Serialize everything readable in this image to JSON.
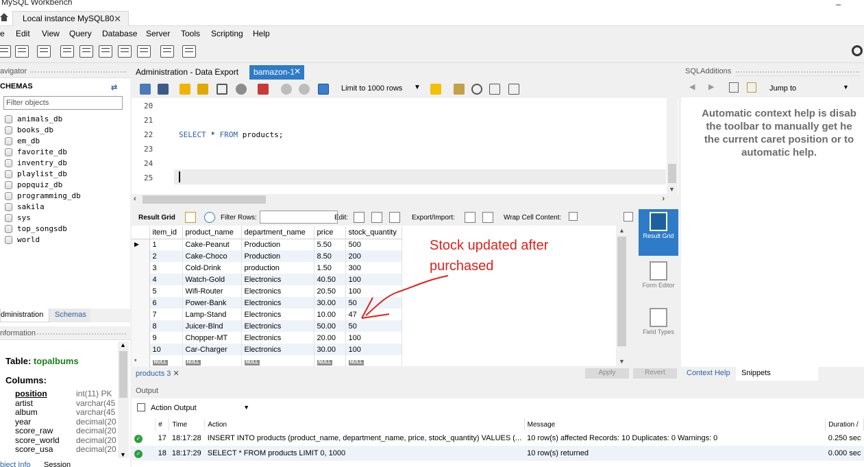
{
  "window": {
    "title": "MySQL Workbench",
    "instance_tab": "Local instance MySQL80"
  },
  "menu": [
    "e",
    "Edit",
    "View",
    "Query",
    "Database",
    "Server",
    "Tools",
    "Scripting",
    "Help"
  ],
  "navigator": {
    "header": "avigator",
    "schemas_label": "CHEMAS",
    "filter_placeholder": "Filter objects",
    "schemas": [
      "animals_db",
      "books_db",
      "em_db",
      "favorite_db",
      "inventry_db",
      "playlist_db",
      "popquiz_db",
      "programming_db",
      "sakila",
      "sys",
      "top_songsdb",
      "world"
    ],
    "tabs": [
      "dministration",
      "Schemas"
    ]
  },
  "information": {
    "header": "nformation",
    "table_label": "Table:",
    "table_name": "topalbums",
    "columns_label": "Columns:",
    "columns": [
      {
        "name": "position",
        "type": "int(11) PK"
      },
      {
        "name": "artist",
        "type": "varchar(45"
      },
      {
        "name": "album",
        "type": "varchar(45"
      },
      {
        "name": "year",
        "type": "decimal(20"
      },
      {
        "name": "score_raw",
        "type": "decimal(20"
      },
      {
        "name": "score_world",
        "type": "decimal(20"
      },
      {
        "name": "score_usa",
        "type": "decimal(20"
      }
    ],
    "bottom_tabs": [
      "bject Info",
      "Session"
    ]
  },
  "editor": {
    "tabs": [
      "Administration - Data Export",
      "bamazon-1"
    ],
    "limit_label": "Limit to 1000 rows",
    "lines": [
      "20",
      "21",
      "22",
      "23",
      "24",
      "25"
    ],
    "sql_keyword_1": "SELECT",
    "sql_star": "*",
    "sql_keyword_2": "FROM",
    "sql_rest": "products;"
  },
  "result_toolbar": {
    "result_grid": "Result Grid",
    "filter_rows": "Filter Rows:",
    "edit": "Edit:",
    "export_import": "Export/Import:",
    "wrap": "Wrap Cell Content:"
  },
  "grid": {
    "columns": [
      "item_id",
      "product_name",
      "department_name",
      "price",
      "stock_quantity"
    ],
    "rows": [
      [
        "1",
        "Cake-Peanut",
        "Production",
        "5.50",
        "500"
      ],
      [
        "2",
        "Cake-Choco",
        "Production",
        "8.50",
        "200"
      ],
      [
        "3",
        "Cold-Drink",
        "production",
        "1.50",
        "300"
      ],
      [
        "4",
        "Watch-Gold",
        "Electronics",
        "40.50",
        "100"
      ],
      [
        "5",
        "Wifi-Router",
        "Electronics",
        "20.50",
        "100"
      ],
      [
        "6",
        "Power-Bank",
        "Electronics",
        "30.00",
        "50"
      ],
      [
        "7",
        "Lamp-Stand",
        "Electronics",
        "10.00",
        "47"
      ],
      [
        "8",
        "Juicer-Blnd",
        "Electronics",
        "50.00",
        "50"
      ],
      [
        "9",
        "Chopper-MT",
        "Electronics",
        "20.00",
        "100"
      ],
      [
        "10",
        "Car-Charger",
        "Electronics",
        "30.00",
        "100"
      ]
    ],
    "null_label": "NULL"
  },
  "annotation": {
    "line1": "Stock updated after",
    "line2": "purchased",
    "color": "#e0201a"
  },
  "side_panel": [
    "Result Grid",
    "Form Editor",
    "Field Types"
  ],
  "result_footer": {
    "tab": "products 3",
    "apply": "Apply",
    "revert": "Revert"
  },
  "output": {
    "header": "Output",
    "selector": "Action Output",
    "columns": [
      "#",
      "Time",
      "Action",
      "Message",
      "Duration /"
    ],
    "rows": [
      [
        "17",
        "18:17:28",
        "INSERT INTO products (product_name, department_name, price, stock_quantity) VALUES (...",
        "10 row(s) affected Records: 10  Duplicates: 0  Warnings: 0",
        "0.250 sec"
      ],
      [
        "18",
        "18:17:29",
        "SELECT * FROM products LIMIT 0, 1000",
        "10 row(s) returned",
        "0.000 sec"
      ]
    ]
  },
  "sql_additions": {
    "header": "SQLAdditions",
    "jump_to": "Jump to",
    "help_lines": [
      "Automatic context help is disab",
      "the toolbar to manually get he",
      "the current caret position or to",
      "automatic help."
    ],
    "tabs": [
      "Context Help",
      "Snippets"
    ]
  },
  "colors": {
    "accent": "#2e7bc8",
    "link": "#2b5ea7",
    "ok": "#2e9e3c"
  }
}
